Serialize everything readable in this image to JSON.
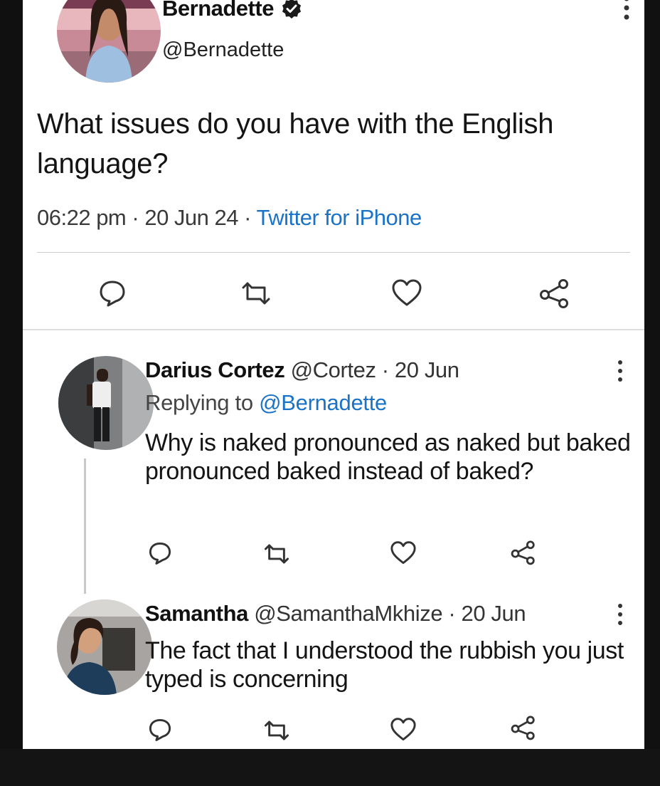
{
  "tweet": {
    "author_name": "Bernadette",
    "author_handle": "@Bernadette",
    "text": "What issues do you have with the English language?",
    "time": "06:22 pm",
    "date": "20 Jun 24",
    "source": "Twitter for iPhone",
    "separator": " · "
  },
  "replies": [
    {
      "name": "Darius Cortez",
      "handle": "@Cortez",
      "date": "20 Jun",
      "replying_prefix": "Replying to ",
      "replying_to": "@Bernadette",
      "text": "Why is naked pronounced as naked but baked pronounced baked instead of baked?"
    },
    {
      "name": "Samantha",
      "handle": "@SamanthaMkhize",
      "date": "20 Jun",
      "text": "The fact that I understood the rubbish you just typed is concerning"
    }
  ],
  "icons": [
    "verified-badge-icon",
    "more-options-icon",
    "reply-icon",
    "retweet-icon",
    "like-icon",
    "share-icon"
  ],
  "colors": {
    "link": "#1a73c7",
    "text": "#141414",
    "muted": "#3a3a3a",
    "divider": "#cccccc"
  }
}
